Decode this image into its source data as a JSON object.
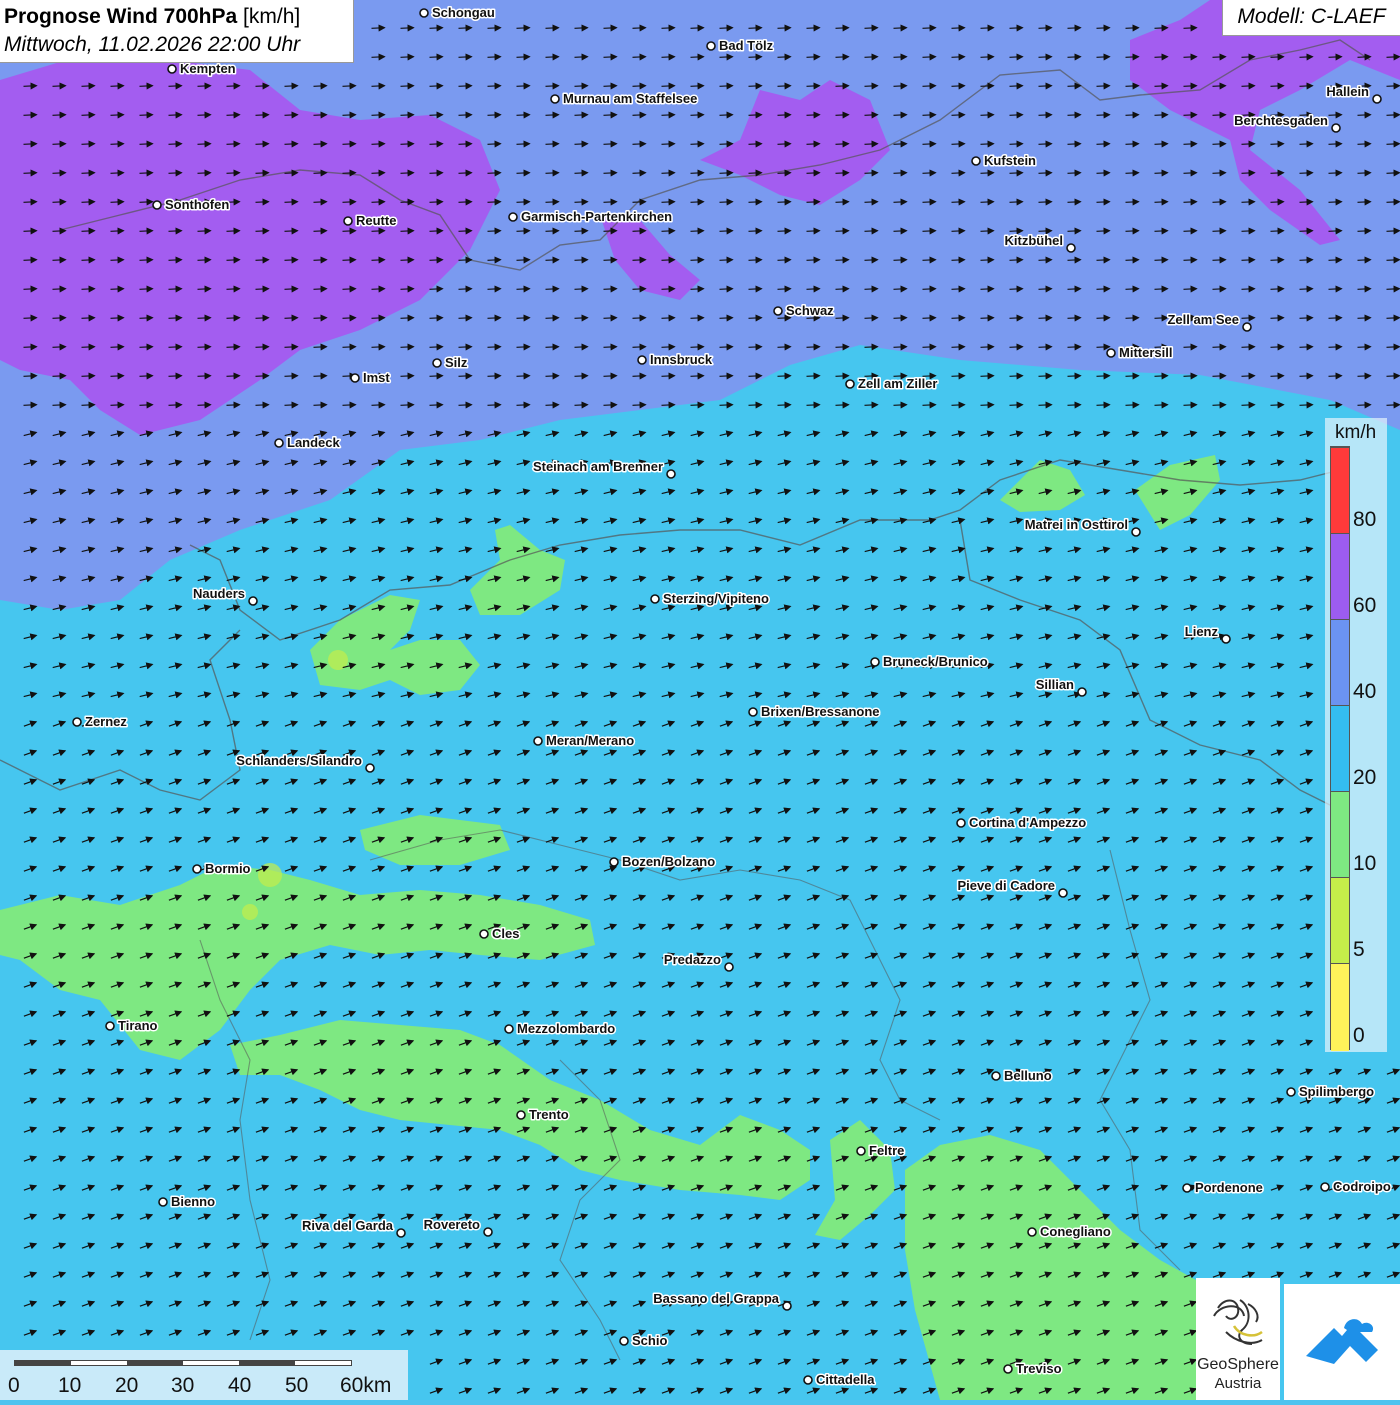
{
  "header": {
    "title_bold": "Prognose Wind 700hPa",
    "title_unit": "[km/h]",
    "datetime": "Mittwoch, 11.02.2026 22:00 Uhr",
    "model": "Modell: C-LAEF"
  },
  "legend": {
    "unit": "km/h",
    "ticks": [
      "80",
      "60",
      "40",
      "20",
      "10",
      "5",
      "0"
    ],
    "colors": [
      "#ff3a3a",
      "#9c5cf0",
      "#6b93f2",
      "#34bdf1",
      "#7ee882",
      "#c5ee4a",
      "#fff35a"
    ]
  },
  "scale": {
    "ticks": [
      "0",
      "10",
      "20",
      "30",
      "40",
      "50",
      "60km"
    ]
  },
  "logo": {
    "name_line1": "GeoSphere",
    "name_line2": "Austria"
  },
  "colors": {
    "band_10_20": "#7ee882",
    "band_20_40": "#46c6ef",
    "band_40_60": "#7a9af0",
    "band_60_80": "#a35df0"
  },
  "wind": {
    "direction": "west to east, slightly north-east in south"
  },
  "cities": [
    {
      "name": "Schongau"
    },
    {
      "name": "Bad Tölz"
    },
    {
      "name": "Kempten"
    },
    {
      "name": "Murnau am Staffelsee"
    },
    {
      "name": "Hallein"
    },
    {
      "name": "Berchtesgaden"
    },
    {
      "name": "Kufstein"
    },
    {
      "name": "Sonthofen"
    },
    {
      "name": "Reutte"
    },
    {
      "name": "Garmisch-Partenkirchen"
    },
    {
      "name": "Kitzbühel"
    },
    {
      "name": "Schwaz"
    },
    {
      "name": "Zell am See"
    },
    {
      "name": "Mittersill"
    },
    {
      "name": "Innsbruck"
    },
    {
      "name": "Silz"
    },
    {
      "name": "Imst"
    },
    {
      "name": "Zell am Ziller"
    },
    {
      "name": "Landeck"
    },
    {
      "name": "Steinach am Brenner"
    },
    {
      "name": "Matrei in Osttirol"
    },
    {
      "name": "Nauders"
    },
    {
      "name": "Sterzing/Vipiteno"
    },
    {
      "name": "Lienz"
    },
    {
      "name": "Bruneck/Brunico"
    },
    {
      "name": "Sillian"
    },
    {
      "name": "Zernez"
    },
    {
      "name": "Brixen/Bressanone"
    },
    {
      "name": "Meran/Merano"
    },
    {
      "name": "Schlanders/Silandro"
    },
    {
      "name": "Cortina d'Ampezzo"
    },
    {
      "name": "Bormio"
    },
    {
      "name": "Bozen/Bolzano"
    },
    {
      "name": "Pieve di Cadore"
    },
    {
      "name": "Cles"
    },
    {
      "name": "Predazzo"
    },
    {
      "name": "Tirano"
    },
    {
      "name": "Mezzolombardo"
    },
    {
      "name": "Belluno"
    },
    {
      "name": "Spilimbergo"
    },
    {
      "name": "Trento"
    },
    {
      "name": "Feltre"
    },
    {
      "name": "Pordenone"
    },
    {
      "name": "Codroipo"
    },
    {
      "name": "Bienno"
    },
    {
      "name": "Riva del Garda"
    },
    {
      "name": "Rovereto"
    },
    {
      "name": "Conegliano"
    },
    {
      "name": "Bassano del Grappa"
    },
    {
      "name": "Schio"
    },
    {
      "name": "Treviso"
    },
    {
      "name": "Cittadella"
    }
  ]
}
